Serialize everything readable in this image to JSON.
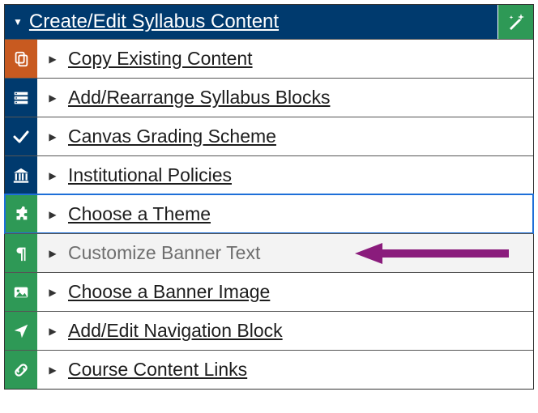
{
  "header": {
    "title": "Create/Edit Syllabus Content",
    "magic_icon": "magic-wand-icon"
  },
  "rows": [
    {
      "icon": "copy-icon",
      "icon_bg": "orange",
      "label": "Copy Existing Content",
      "muted": false,
      "highlight": false
    },
    {
      "icon": "blocks-icon",
      "icon_bg": "navy",
      "label": "Add/Rearrange Syllabus Blocks",
      "muted": false,
      "highlight": false
    },
    {
      "icon": "check-icon",
      "icon_bg": "navy",
      "label": "Canvas Grading Scheme",
      "muted": false,
      "highlight": false
    },
    {
      "icon": "institution-icon",
      "icon_bg": "navy",
      "label": "Institutional Policies",
      "muted": false,
      "highlight": false
    },
    {
      "icon": "puzzle-icon",
      "icon_bg": "green",
      "label": "Choose a Theme",
      "muted": false,
      "highlight": true
    },
    {
      "icon": "pilcrow-icon",
      "icon_bg": "green",
      "label": "Customize Banner Text",
      "muted": true,
      "highlight": false,
      "arrow": true
    },
    {
      "icon": "image-icon",
      "icon_bg": "green",
      "label": "Choose a Banner Image",
      "muted": false,
      "highlight": false
    },
    {
      "icon": "nav-arrow-icon",
      "icon_bg": "green",
      "label": "Add/Edit Navigation Block",
      "muted": false,
      "highlight": false
    },
    {
      "icon": "link-icon",
      "icon_bg": "green",
      "label": "Course Content Links",
      "muted": false,
      "highlight": false
    }
  ],
  "annotation": {
    "color": "#8a1c7c"
  }
}
